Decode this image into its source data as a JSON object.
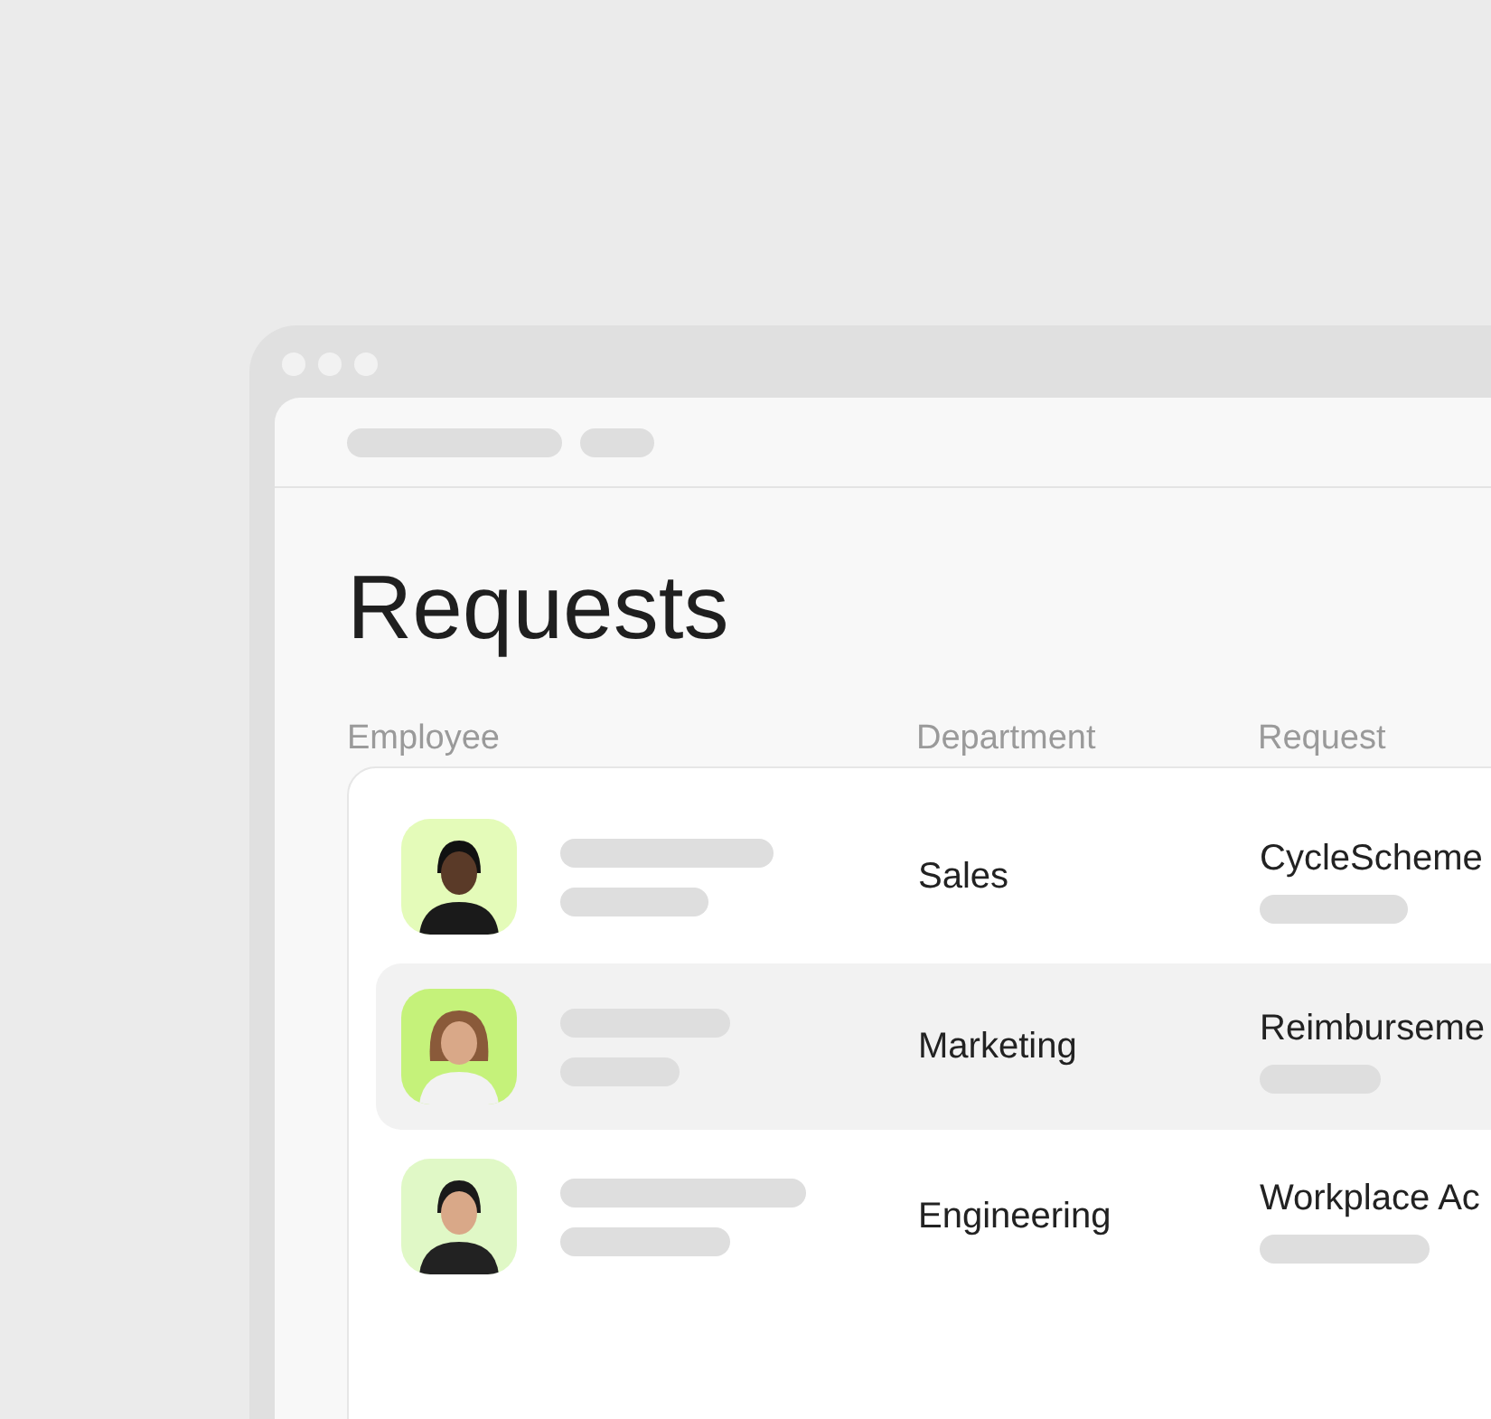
{
  "page": {
    "title": "Requests"
  },
  "table": {
    "columns": [
      "Employee",
      "Department",
      "Request"
    ],
    "rows": [
      {
        "selected": false,
        "color": "#e4fbb9",
        "department": "Sales",
        "request": "CycleScheme"
      },
      {
        "selected": true,
        "color": "#c5f27a",
        "department": "Marketing",
        "request": "Reimburseme"
      },
      {
        "selected": false,
        "color": "#e0f8c6",
        "department": "Engineering",
        "request": "Workplace Ac"
      }
    ]
  }
}
